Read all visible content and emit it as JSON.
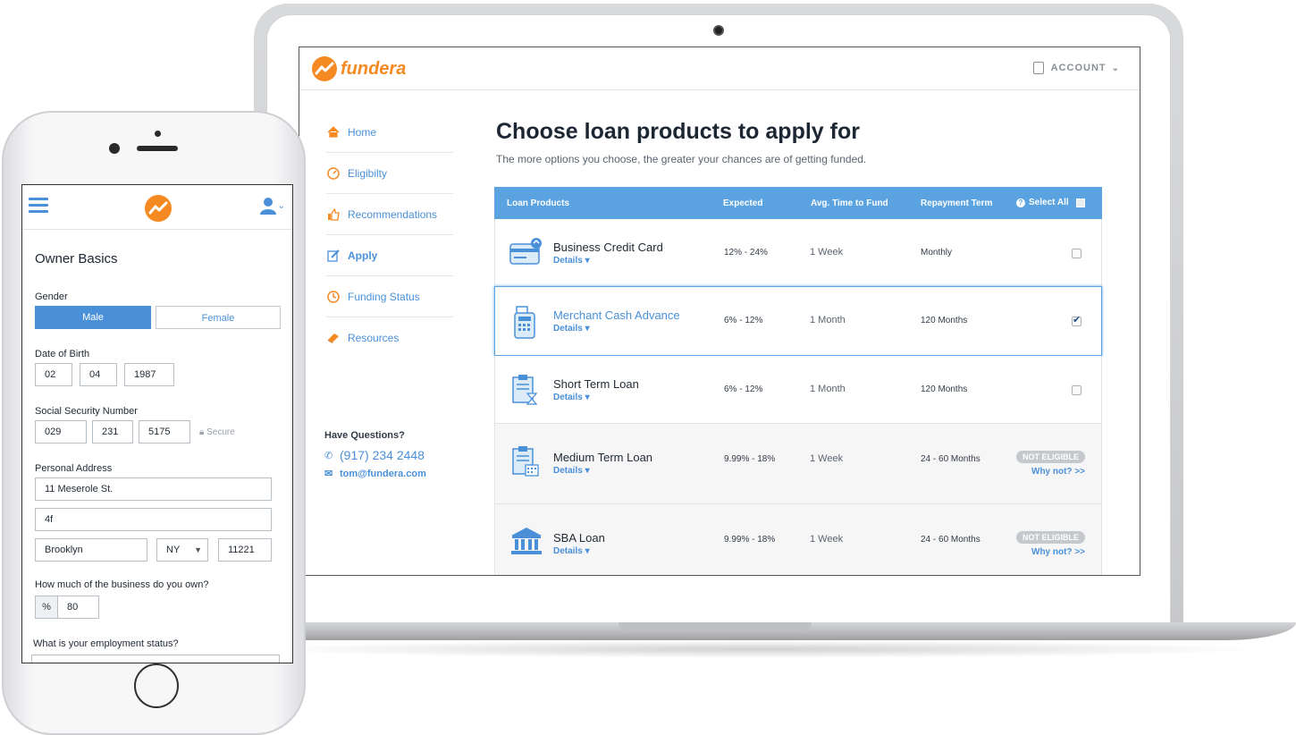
{
  "desktop": {
    "brand": {
      "name": "fundera",
      "color": "#f58a23"
    },
    "account": {
      "label": "ACCOUNT",
      "icon": "document-icon"
    },
    "nav": [
      {
        "label": "Home",
        "icon": "home-icon",
        "active": false
      },
      {
        "label": "Eligibilty",
        "icon": "speedometer-icon",
        "active": false
      },
      {
        "label": "Recommendations",
        "icon": "thumbs-up-icon",
        "active": false
      },
      {
        "label": "Apply",
        "icon": "edit-icon",
        "active": true
      },
      {
        "label": "Funding Status",
        "icon": "clock-icon",
        "active": false
      },
      {
        "label": "Resources",
        "icon": "book-icon",
        "active": false
      }
    ],
    "contact": {
      "title": "Have Questions?",
      "phone": "(917) 234 2448",
      "email": "tom@fundera.com"
    },
    "page": {
      "title": "Choose loan products to apply for",
      "subtitle": "The more options you choose, the greater your chances are of getting funded."
    },
    "table": {
      "headers": {
        "product": "Loan Products",
        "expected": "Expected",
        "time": "Avg. Time to Fund",
        "term": "Repayment Term",
        "select_all": "Select All"
      },
      "details_label": "Details",
      "rows": [
        {
          "name": "Business Credit Card",
          "expected": "12% - 24%",
          "time": "1 Week",
          "term": "Monthly",
          "checked": false,
          "eligible": true,
          "icon": "credit-card-icon"
        },
        {
          "name": "Merchant Cash Advance",
          "expected": "6% - 12%",
          "time": "1 Month",
          "term": "120 Months",
          "checked": true,
          "eligible": true,
          "icon": "card-terminal-icon"
        },
        {
          "name": "Short Term Loan",
          "expected": "6% - 12%",
          "time": "1 Month",
          "term": "120 Months",
          "checked": false,
          "eligible": true,
          "icon": "clipboard-hourglass-icon"
        },
        {
          "name": "Medium Term Loan",
          "expected": "9.99% - 18%",
          "time": "1 Week",
          "term": "24 - 60 Months",
          "checked": false,
          "eligible": false,
          "icon": "clipboard-calendar-icon"
        },
        {
          "name": "SBA Loan",
          "expected": "9.99% - 18%",
          "time": "1 Week",
          "term": "24 - 60 Months",
          "checked": false,
          "eligible": false,
          "icon": "bank-building-icon"
        }
      ],
      "not_eligible_label": "NOT ELIGIBLE",
      "why_not_label": "Why not? >>"
    },
    "accent": "#5aa3e0"
  },
  "mobile": {
    "section_title": "Owner Basics",
    "gender": {
      "label": "Gender",
      "options": [
        "Male",
        "Female"
      ],
      "selected": "Male"
    },
    "dob": {
      "label": "Date of Birth",
      "month": "02",
      "day": "04",
      "year": "1987"
    },
    "ssn": {
      "label": "Social Security Number",
      "part1": "029",
      "part2": "231",
      "part3": "5175",
      "secure_label": "Secure"
    },
    "address": {
      "label": "Personal Address",
      "line1": "11 Meserole St.",
      "line2": "4f",
      "city": "Brooklyn",
      "state": "NY",
      "zip": "11221"
    },
    "ownership": {
      "label": "How much of the business do you own?",
      "unit": "%",
      "value": "80"
    },
    "employment": {
      "label": "What is your employment status?"
    }
  }
}
